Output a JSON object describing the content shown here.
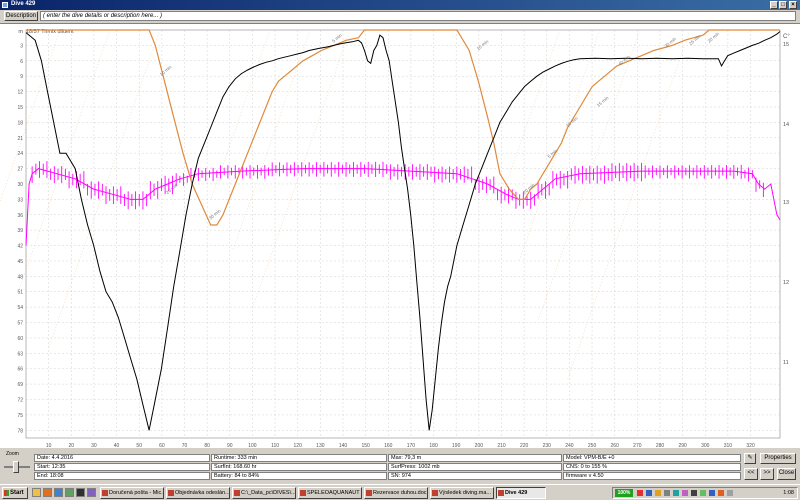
{
  "window": {
    "title": "Dive 429",
    "minimize": "_",
    "maximize": "□",
    "close": "×"
  },
  "description": {
    "button_label": "Description",
    "placeholder": "( enter the dive details or description here... )"
  },
  "plot": {
    "gas_label": "18/57 Trimix diluent",
    "depth_ticks": [
      "3",
      "6",
      "9",
      "12",
      "15",
      "18",
      "21",
      "24",
      "27",
      "30",
      "33",
      "36",
      "39",
      "42",
      "45",
      "48",
      "51",
      "54",
      "57",
      "60",
      "63",
      "66",
      "69",
      "72",
      "75",
      "78"
    ],
    "time_ticks": [
      "10",
      "20",
      "30",
      "40",
      "50",
      "60",
      "70",
      "80",
      "90",
      "100",
      "110",
      "120",
      "130",
      "140",
      "150",
      "160",
      "170",
      "180",
      "190",
      "200",
      "210",
      "220",
      "230",
      "240",
      "250",
      "260",
      "270",
      "280",
      "290",
      "300",
      "310",
      "320"
    ],
    "right_unit": "C°",
    "right_ticks": [
      "15",
      "14",
      "13",
      "12",
      "11"
    ],
    "ceiling_labels": [
      "10 min",
      "20 min",
      "30 min",
      "5 min",
      "10 min",
      "20 min",
      "40 min",
      "30 min",
      "25 min",
      "20 min",
      "15 min",
      "10 min",
      "5 min"
    ],
    "colors": {
      "depth": "#000000",
      "ceiling": "#e08a3a",
      "ppo2": "#ff00ff",
      "grid": "#c8c8c8"
    }
  },
  "info": {
    "date": "Date: 4.4.2016",
    "start": "Start: 12:35",
    "end": "End: 18:08",
    "runtime": "Runtime: 333 min",
    "surfint": "SurfInt: 168.60 hr",
    "battery": "Battery: 84 to 84%",
    "max": "Max: 79,3 m",
    "surfpress": "SurfPress: 1002 mb",
    "sn": "SN: 974",
    "model": "Model: VPM-B/E +0",
    "cns": "CNS: 0 to 155 %",
    "firmware": "firmware v 4.50",
    "zoom_label": "Zoom",
    "properties": "Properties",
    "prev2": "<<",
    "next2": ">>",
    "close": "Close"
  },
  "taskbar": {
    "start": "Start",
    "tasks": [
      "Doručená pošta - Mic...",
      "Objednávka odeslán...",
      "C:\\_Data_pc\\DIVES\\...",
      "SPELEOAQUANAUT - C...",
      "Rezervace duhou.doc...",
      "Výsledek diving.ma...",
      "Dive 429"
    ],
    "battery": "100%",
    "clock": "1:08"
  }
}
